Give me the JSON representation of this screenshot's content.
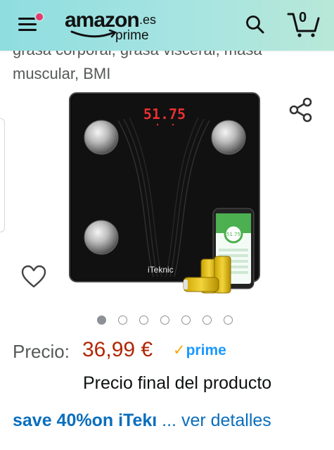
{
  "header": {
    "logo_word": "amazon",
    "logo_tld": ".es",
    "logo_sub": "prime",
    "cart_count": "0"
  },
  "product": {
    "title_cut": "grasa corporal, grasa visceral, masa",
    "title_line": "muscular, BMI",
    "scale_display": "51.75",
    "scale_brand": "iTeknic",
    "phone_reading": "51.75"
  },
  "carousel": {
    "total": 7,
    "active": 0
  },
  "price": {
    "label": "Precio:",
    "value": "36,99 €",
    "prime": "prime",
    "final_note": "Precio final del producto"
  },
  "promo": {
    "strong": "save 40%on iTekı",
    "link": "... ver detalles"
  },
  "icons": {
    "menu": "hamburger-menu-icon",
    "search": "search-icon",
    "cart": "cart-icon",
    "share": "share-icon",
    "wishlist": "heart-icon"
  },
  "colors": {
    "header_bg": "#a6e4e1",
    "price": "#b12704",
    "link": "#0a6ebd",
    "prime": "#1a98ff",
    "notification_dot": "#e8396f"
  }
}
